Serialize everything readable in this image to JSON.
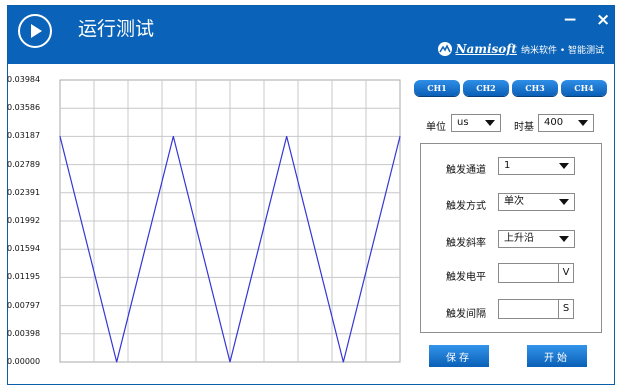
{
  "window": {
    "title": "运行测试",
    "minimize": "−",
    "close": "×"
  },
  "brand": {
    "logo_text": "Namisoft",
    "tagline": "纳米软件 • 智能测试"
  },
  "chart_data": {
    "type": "line",
    "x": [
      0,
      1,
      2,
      3,
      4,
      5,
      6
    ],
    "series": [
      {
        "values": [
          0.03187,
          0,
          0.03187,
          0,
          0.03187,
          0,
          0.03187
        ]
      }
    ],
    "ylim": [
      0,
      0.03984
    ],
    "yticks": [
      "0.03984",
      "0.03586",
      "0.03187",
      "0.02789",
      "0.02391",
      "0.01992",
      "0.01594",
      "0.01195",
      "0.00797",
      "0.00398",
      "0.00000"
    ],
    "grid": true,
    "line_color": "#3535d6"
  },
  "channels": [
    "CH1",
    "CH2",
    "CH3",
    "CH4"
  ],
  "unit": {
    "label": "单位",
    "value": "us"
  },
  "timebase": {
    "label": "时基",
    "value": "400"
  },
  "trigger": {
    "channel": {
      "label": "触发通道",
      "value": "1"
    },
    "mode": {
      "label": "触发方式",
      "value": "单次"
    },
    "slope": {
      "label": "触发斜率",
      "value": "上升沿"
    },
    "level": {
      "label": "触发电平",
      "value": "",
      "unit": "V"
    },
    "interval": {
      "label": "触发间隔",
      "value": "",
      "unit": "S"
    }
  },
  "buttons": {
    "save": "保存",
    "start": "开始"
  },
  "colors": {
    "titlebar": "#0a63b8",
    "button": "#1a78d2"
  }
}
